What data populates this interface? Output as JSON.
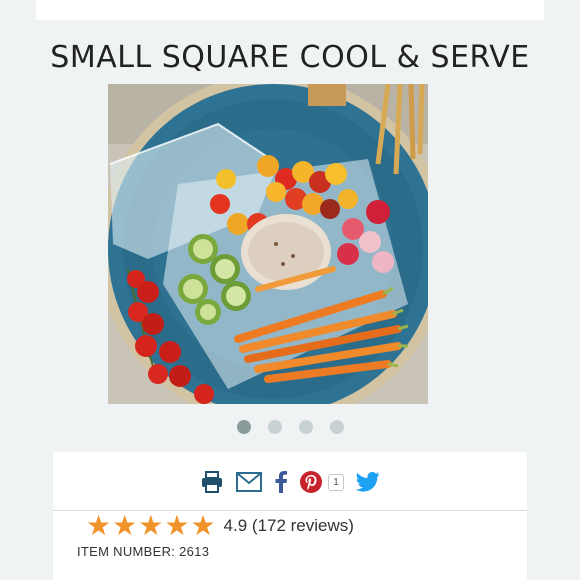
{
  "product": {
    "title": "SMALL SQUARE COOL & SERVE",
    "image_alt": "Small square cool and serve tray with vegetables and dip"
  },
  "carousel": {
    "slides": 4,
    "active_index": 0
  },
  "share": {
    "icons": [
      "print-icon",
      "email-icon",
      "facebook-icon",
      "pinterest-icon",
      "twitter-icon"
    ],
    "pinterest_count": "1"
  },
  "rating": {
    "stars": 5,
    "value_text": "4.9 (172 reviews)"
  },
  "item": {
    "number_label": "ITEM NUMBER: 2613"
  },
  "colors": {
    "accent_blue": "#2a6b8f",
    "star_orange": "#f0932b",
    "pinterest_red": "#c8232c",
    "twitter_blue": "#1da1f2",
    "facebook_blue": "#3b5998"
  }
}
